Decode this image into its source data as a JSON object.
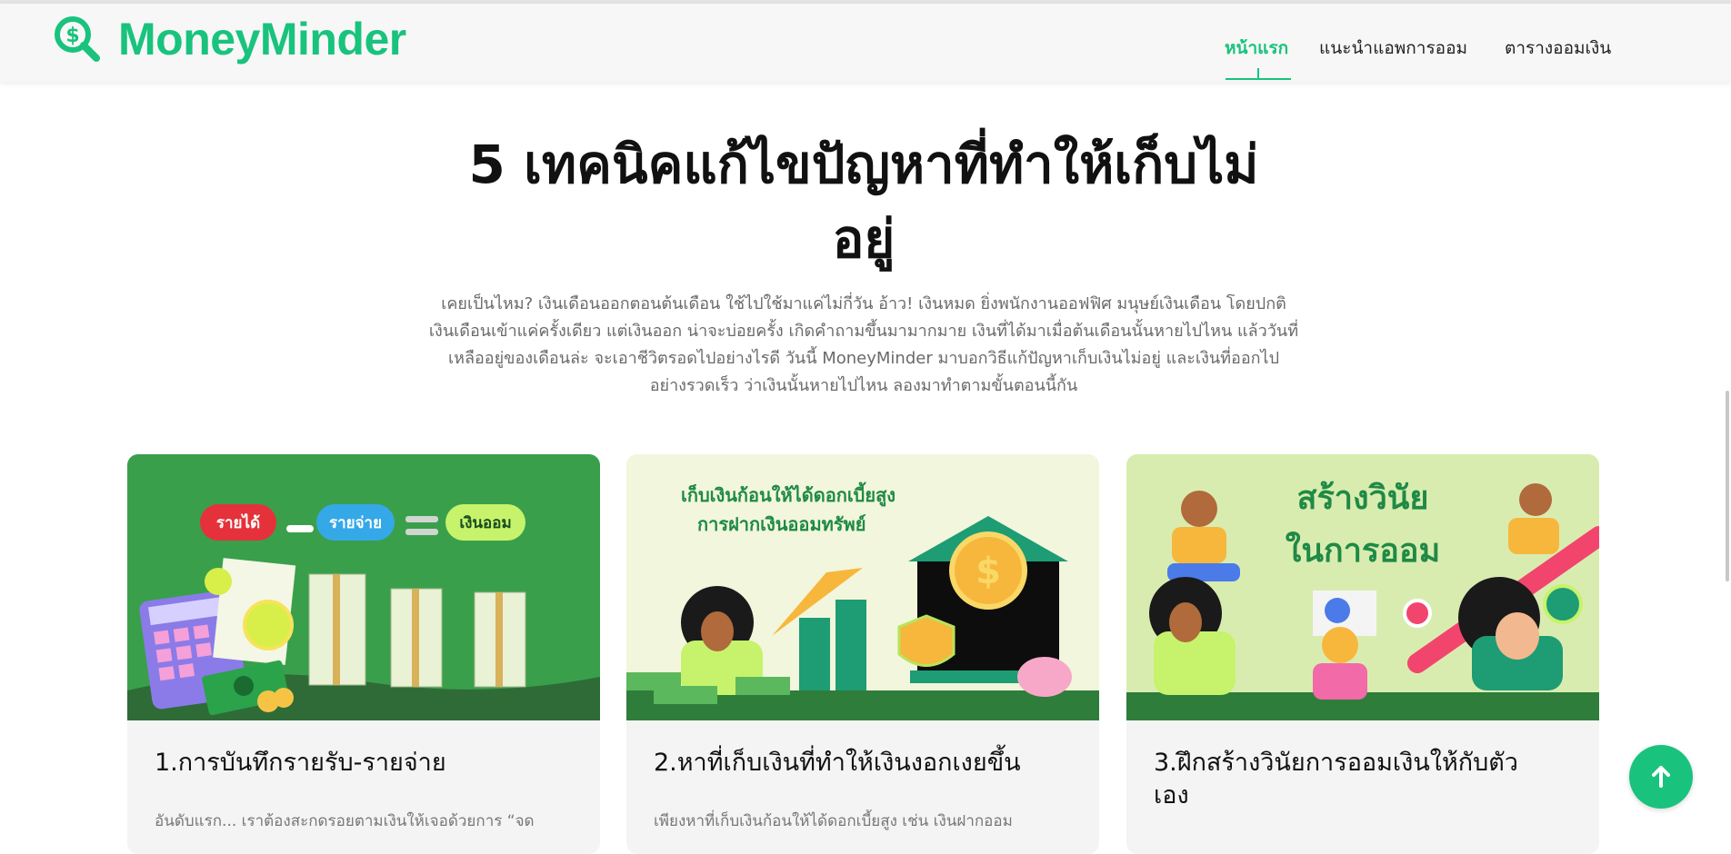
{
  "brand": {
    "name": "MoneyMinder",
    "color": "#19c37d",
    "icon": "dollar-search-icon"
  },
  "nav": {
    "items": [
      {
        "label": "หน้าแรก",
        "active": true
      },
      {
        "label": "แนะนำแอพการออม",
        "active": false
      },
      {
        "label": "ตารางออมเงิน",
        "active": false
      }
    ]
  },
  "hero": {
    "title_line1": "5 เทคนิคแก้ไขปัญหาที่ทำให้เก็บไม่",
    "title_line2": "อยู่",
    "intro_lines": [
      "เคยเป็นไหม? เงินเดือนออกตอนต้นเดือน ใช้ไปใช้มาแค่ไม่กี่วัน อ้าว! เงินหมด ยิ่งพนักงานออฟฟิศ มนุษย์เงินเดือน โดยปกติ",
      "เงินเดือนเข้าแค่ครั้งเดียว แต่เงินออก น่าจะบ่อยครั้ง เกิดคำถามขึ้นมามากมาย เงินที่ได้มาเมื่อต้นเดือนนั้นหายไปไหน แล้ววันที่",
      "เหลืออยู่ของเดือนล่ะ จะเอาชีวิตรอดไปอย่างไรดี วันนี้ MoneyMinder มาบอกวิธีแก้ปัญหาเก็บเงินไม่อยู่ และเงินที่ออกไป",
      "อย่างรวดเร็ว ว่าเงินนั้นหายไปไหน ลองมาทำตามขั้นตอนนี้กัน"
    ]
  },
  "cards": [
    {
      "title": "1.การบันทึกรายรับ-รายจ่าย",
      "text": "อันดับแรก... เราต้องสะกดรอยตามเงินให้เจอด้วยการ “จด",
      "image": {
        "pill_income": "รายได้",
        "pill_expense": "รายจ่าย",
        "pill_saving": "เงินออม"
      }
    },
    {
      "title": "2.หาที่เก็บเงินที่ทำให้เงินงอกเงยขึ้น",
      "text": "เพียงหาที่เก็บเงินก้อนให้ได้ดอกเบี้ยสูง เช่น เงินฝากออม",
      "image": {
        "line1": "เก็บเงินก้อนให้ได้ดอกเบี้ยสูง",
        "line2": "การฝากเงินออมทรัพย์"
      }
    },
    {
      "title_line1": "3.ฝึกสร้างวินัยการออมเงินให้กับตัว",
      "title_line2": "เอง",
      "image": {
        "line1": "สร้างวินัย",
        "line2": "ในการออม"
      }
    }
  ],
  "scroll_top": {
    "icon": "arrow-up-icon"
  }
}
